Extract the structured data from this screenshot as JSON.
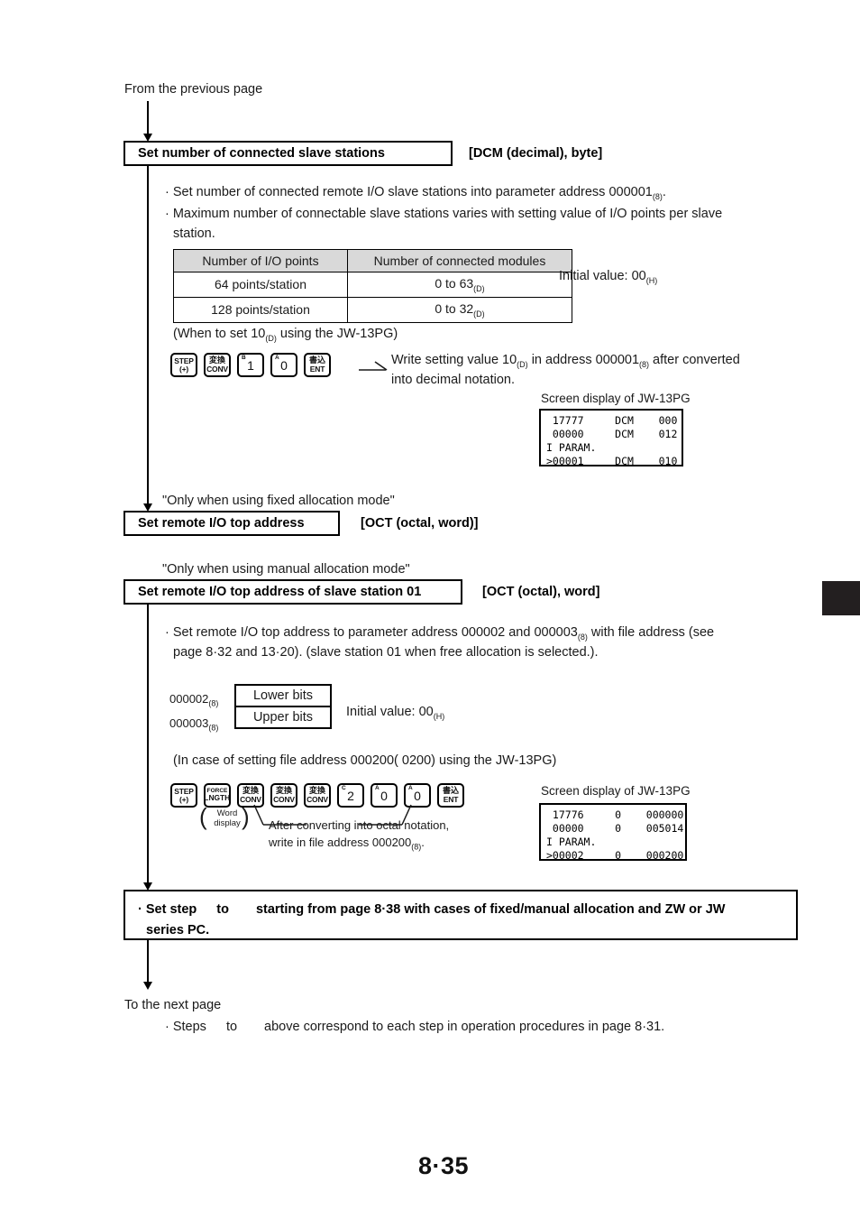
{
  "document": {
    "from_previous_page": "From the previous page",
    "to_next_page": "To the next page",
    "page_number": "8·35"
  },
  "section1": {
    "box_label": "Set number of connected slave stations",
    "box_tag": "[DCM (decimal), byte]",
    "bullet1_a": "· Set number of connected remote I/O slave stations into parameter address 000001",
    "bullet1_sub": "(8)",
    "bullet1_b": ".",
    "bullet2_a": "· Maximum number of connectable slave stations varies with setting value of I/O points per slave",
    "bullet2_b": "station.",
    "table": {
      "headers": [
        "Number of I/O points",
        "Number of connected modules"
      ],
      "rows": [
        [
          "64 points/station",
          "0 to 63(D)"
        ],
        [
          "128 points/station",
          "0 to 32(D)"
        ]
      ],
      "row1_col1": "64 points/station",
      "row1_col2_main": "0 to 63",
      "row1_col2_sub": "(D)",
      "row2_col1": "128 points/station",
      "row2_col2_main": "0 to 32",
      "row2_col2_sub": "(D)"
    },
    "initial_value_main": "Initial value: 00",
    "initial_value_sub": "(H)",
    "when_to_set_a": "(When to set 10",
    "when_to_set_sub": "(D)",
    "when_to_set_b": " using the JW-13PG)",
    "keys": [
      {
        "type": "two-line",
        "l1": "STEP",
        "l2": "(+)"
      },
      {
        "type": "jp",
        "jp": "変換",
        "l2": "CONV"
      },
      {
        "type": "num",
        "corner": "B",
        "big": "1"
      },
      {
        "type": "num",
        "corner": "A",
        "big": "0"
      },
      {
        "type": "jp",
        "jp": "書込",
        "l2": "ENT"
      }
    ],
    "write_note_a": "Write setting value 10",
    "write_note_sub1": "(D)",
    "write_note_b": " in address 000001",
    "write_note_sub2": "(8)",
    "write_note_c": " after converted",
    "write_note_d": "into decimal notation.",
    "screen_label": "Screen display of JW-13PG",
    "screen_lines": " 17777     DCM    000\n 00000     DCM    012\nI PARAM.\n>00001     DCM    010"
  },
  "section2": {
    "note_fixed": "\"Only when using fixed allocation mode\"",
    "box_label": "Set remote I/O top address",
    "box_tag": "[OCT (octal, word)]"
  },
  "section3": {
    "note_manual": "\"Only when using manual allocation mode\"",
    "box_label": "Set remote I/O top address of slave station 01",
    "box_tag": "[OCT (octal), word]",
    "bullet_a": "· Set remote I/O top address to parameter address 000002 and 000003",
    "bullet_sub": "(8)",
    "bullet_b": " with file address (see",
    "bullet_c": "page 8·32 and 13·20). (slave station 01 when free allocation is selected.).",
    "addr_lower_main": "000002",
    "addr_lower_sub": "(8)",
    "addr_upper_main": "000003",
    "addr_upper_sub": "(8)",
    "bits_lower": "Lower bits",
    "bits_upper": "Upper bits",
    "initial_value_main": "Initial value: 00",
    "initial_value_sub": "(H)",
    "case_note": "(In case of setting file address 000200(  0200) using the JW-13PG)",
    "keys": [
      {
        "type": "two-line",
        "l1": "STEP",
        "l2": "(+)"
      },
      {
        "type": "force",
        "l1": "FORCE",
        "l2": "LNGTH"
      },
      {
        "type": "jp",
        "jp": "変換",
        "l2": "CONV"
      },
      {
        "type": "jp",
        "jp": "変換",
        "l2": "CONV"
      },
      {
        "type": "jp",
        "jp": "変換",
        "l2": "CONV"
      },
      {
        "type": "num",
        "corner": "C",
        "big": "2"
      },
      {
        "type": "num",
        "corner": "A",
        "big": "0"
      },
      {
        "type": "num",
        "corner": "A",
        "big": "0"
      },
      {
        "type": "jp",
        "jp": "書込",
        "l2": "ENT"
      }
    ],
    "word_display_l1": "Word",
    "word_display_l2": "display",
    "annot_line1": "After converting into octal notation,",
    "annot_line2_a": "write in file address 000200",
    "annot_line2_sub": "(8)",
    "annot_line2_b": ".",
    "screen_label": "Screen display of JW-13PG",
    "screen_lines": " 17776     0    000000\n 00000     0    005014\nI PARAM.\n>00002     0    000200"
  },
  "section4": {
    "note_line1_a": "· Set step",
    "note_line1_b": "to",
    "note_line1_c": "starting from page 8·38 with cases of fixed/manual allocation and ZW or JW",
    "note_line2": "series PC."
  },
  "footer": {
    "steps_a": "· Steps",
    "steps_b": "to",
    "steps_c": "above correspond to each step in operation procedures in page 8·31."
  }
}
